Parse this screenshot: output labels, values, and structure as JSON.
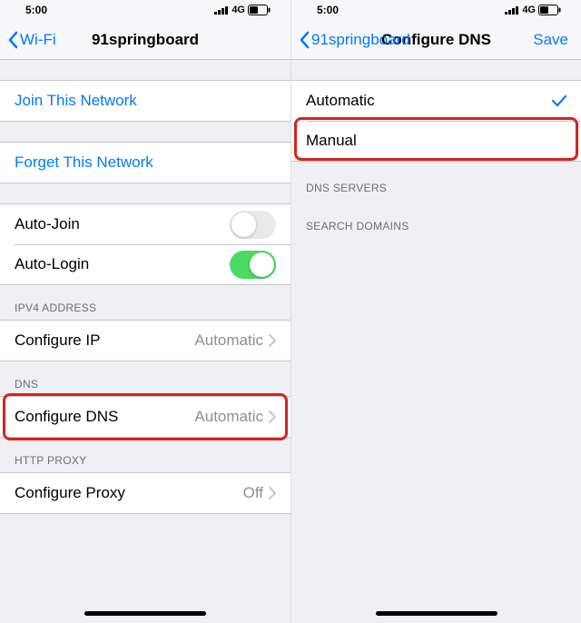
{
  "status": {
    "time": "5:00",
    "carrier": "4G"
  },
  "left": {
    "back_label": "Wi-Fi",
    "title": "91springboard",
    "join_label": "Join This Network",
    "forget_label": "Forget This Network",
    "autojoin_label": "Auto-Join",
    "autologin_label": "Auto-Login",
    "sections": {
      "ipv4": "IPV4 ADDRESS",
      "dns": "DNS",
      "proxy": "HTTP PROXY"
    },
    "configure_ip": {
      "label": "Configure IP",
      "value": "Automatic"
    },
    "configure_dns": {
      "label": "Configure DNS",
      "value": "Automatic"
    },
    "configure_proxy": {
      "label": "Configure Proxy",
      "value": "Off"
    }
  },
  "right": {
    "back_label": "91springboard",
    "title": "Configure DNS",
    "save_label": "Save",
    "option_automatic": "Automatic",
    "option_manual": "Manual",
    "sections": {
      "dns_servers": "DNS SERVERS",
      "search_domains": "SEARCH DOMAINS"
    }
  }
}
